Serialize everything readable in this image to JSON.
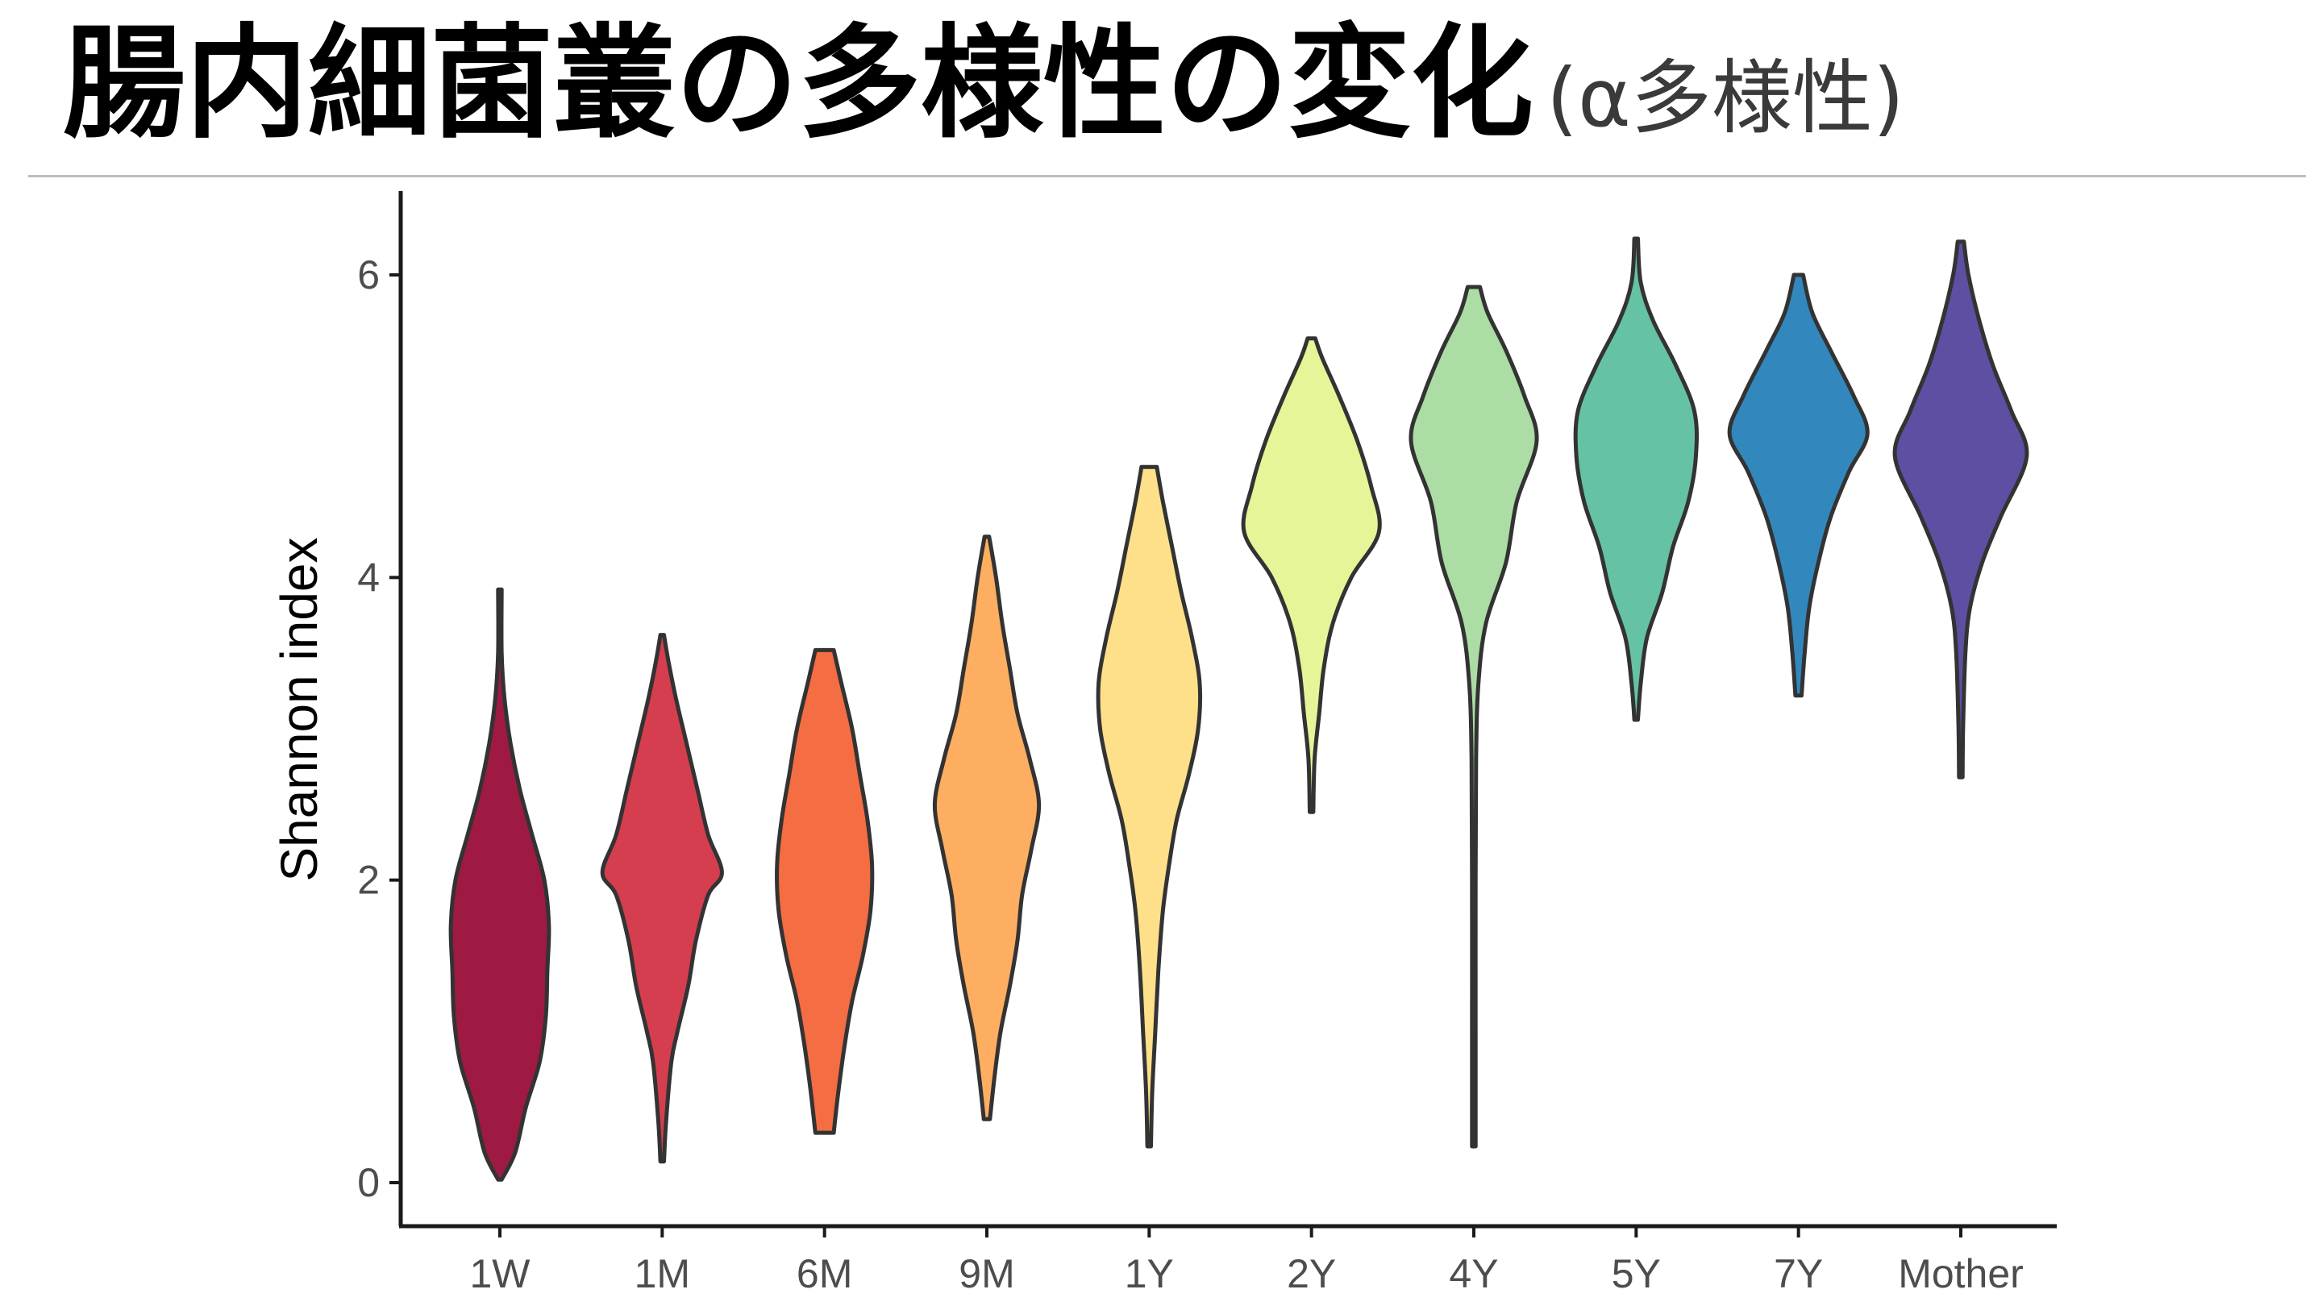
{
  "slide": {
    "title": "腸内細菌叢の多様性の変化",
    "subtitle": "(α多様性)"
  },
  "chart_data": {
    "type": "violin",
    "categories": [
      "1W",
      "1M",
      "6M",
      "9M",
      "1Y",
      "2Y",
      "4Y",
      "5Y",
      "7Y",
      "Mother"
    ],
    "ylabel": "Shannon index",
    "xlabel": "",
    "ylim": [
      -0.3,
      6.5
    ],
    "yticks": [
      0,
      2,
      4,
      6
    ],
    "grid": false,
    "legend": "none",
    "series": [
      {
        "group": "1W",
        "color": "#9E1A42",
        "min": 0.02,
        "max": 3.92,
        "profile": [
          [
            0.02,
            0.01
          ],
          [
            0.2,
            0.2
          ],
          [
            0.5,
            0.34
          ],
          [
            0.8,
            0.52
          ],
          [
            1.1,
            0.6
          ],
          [
            1.4,
            0.62
          ],
          [
            1.7,
            0.64
          ],
          [
            2.0,
            0.58
          ],
          [
            2.3,
            0.42
          ],
          [
            2.6,
            0.26
          ],
          [
            2.9,
            0.14
          ],
          [
            3.2,
            0.06
          ],
          [
            3.5,
            0.02
          ],
          [
            3.92,
            0.01
          ]
        ]
      },
      {
        "group": "1M",
        "color": "#D53E4F",
        "min": 0.14,
        "max": 3.62,
        "profile": [
          [
            0.14,
            0.02
          ],
          [
            0.4,
            0.05
          ],
          [
            0.8,
            0.12
          ],
          [
            1.0,
            0.2
          ],
          [
            1.3,
            0.34
          ],
          [
            1.6,
            0.44
          ],
          [
            1.9,
            0.6
          ],
          [
            2.05,
            0.78
          ],
          [
            2.3,
            0.6
          ],
          [
            2.6,
            0.46
          ],
          [
            2.9,
            0.32
          ],
          [
            3.2,
            0.18
          ],
          [
            3.45,
            0.08
          ],
          [
            3.62,
            0.02
          ]
        ]
      },
      {
        "group": "6M",
        "color": "#F46D43",
        "min": 0.33,
        "max": 3.52,
        "profile": [
          [
            0.33,
            0.12
          ],
          [
            0.6,
            0.18
          ],
          [
            0.9,
            0.26
          ],
          [
            1.2,
            0.36
          ],
          [
            1.5,
            0.5
          ],
          [
            1.8,
            0.6
          ],
          [
            2.1,
            0.62
          ],
          [
            2.4,
            0.56
          ],
          [
            2.7,
            0.46
          ],
          [
            3.0,
            0.36
          ],
          [
            3.3,
            0.22
          ],
          [
            3.52,
            0.12
          ]
        ]
      },
      {
        "group": "9M",
        "color": "#FDAE61",
        "min": 0.42,
        "max": 4.27,
        "profile": [
          [
            0.42,
            0.04
          ],
          [
            0.7,
            0.1
          ],
          [
            1.0,
            0.18
          ],
          [
            1.3,
            0.3
          ],
          [
            1.6,
            0.4
          ],
          [
            1.9,
            0.46
          ],
          [
            2.2,
            0.58
          ],
          [
            2.5,
            0.68
          ],
          [
            2.8,
            0.56
          ],
          [
            3.1,
            0.4
          ],
          [
            3.4,
            0.3
          ],
          [
            3.7,
            0.2
          ],
          [
            4.0,
            0.12
          ],
          [
            4.27,
            0.03
          ]
        ]
      },
      {
        "group": "1Y",
        "color": "#FEE08B",
        "min": 0.24,
        "max": 4.73,
        "profile": [
          [
            0.24,
            0.01
          ],
          [
            0.6,
            0.04
          ],
          [
            1.0,
            0.08
          ],
          [
            1.4,
            0.12
          ],
          [
            1.8,
            0.18
          ],
          [
            2.1,
            0.26
          ],
          [
            2.4,
            0.36
          ],
          [
            2.7,
            0.52
          ],
          [
            3.0,
            0.64
          ],
          [
            3.3,
            0.66
          ],
          [
            3.6,
            0.56
          ],
          [
            3.9,
            0.42
          ],
          [
            4.2,
            0.3
          ],
          [
            4.5,
            0.18
          ],
          [
            4.73,
            0.1
          ]
        ]
      },
      {
        "group": "2Y",
        "color": "#E6F598",
        "min": 2.45,
        "max": 5.58,
        "profile": [
          [
            2.45,
            0.02
          ],
          [
            2.8,
            0.04
          ],
          [
            3.1,
            0.1
          ],
          [
            3.4,
            0.16
          ],
          [
            3.7,
            0.28
          ],
          [
            4.0,
            0.52
          ],
          [
            4.3,
            0.88
          ],
          [
            4.6,
            0.78
          ],
          [
            4.9,
            0.6
          ],
          [
            5.2,
            0.36
          ],
          [
            5.45,
            0.14
          ],
          [
            5.58,
            0.05
          ]
        ]
      },
      {
        "group": "4Y",
        "color": "#ABDDA4",
        "min": 0.24,
        "max": 5.92,
        "profile": [
          [
            0.24,
            0.01
          ],
          [
            1.0,
            0.02
          ],
          [
            2.0,
            0.02
          ],
          [
            2.8,
            0.03
          ],
          [
            3.3,
            0.06
          ],
          [
            3.7,
            0.16
          ],
          [
            4.1,
            0.42
          ],
          [
            4.5,
            0.56
          ],
          [
            4.9,
            0.82
          ],
          [
            5.2,
            0.66
          ],
          [
            5.5,
            0.42
          ],
          [
            5.75,
            0.18
          ],
          [
            5.92,
            0.08
          ]
        ]
      },
      {
        "group": "5Y",
        "color": "#66C2A5",
        "min": 3.06,
        "max": 6.24,
        "profile": [
          [
            3.06,
            0.02
          ],
          [
            3.3,
            0.06
          ],
          [
            3.6,
            0.14
          ],
          [
            3.9,
            0.34
          ],
          [
            4.2,
            0.48
          ],
          [
            4.5,
            0.68
          ],
          [
            4.8,
            0.78
          ],
          [
            5.1,
            0.76
          ],
          [
            5.4,
            0.52
          ],
          [
            5.7,
            0.22
          ],
          [
            5.95,
            0.06
          ],
          [
            6.24,
            0.01
          ]
        ]
      },
      {
        "group": "7Y",
        "color": "#3288BD",
        "min": 3.22,
        "max": 6.0,
        "profile": [
          [
            3.22,
            0.04
          ],
          [
            3.5,
            0.08
          ],
          [
            3.8,
            0.14
          ],
          [
            4.1,
            0.26
          ],
          [
            4.4,
            0.42
          ],
          [
            4.7,
            0.66
          ],
          [
            4.95,
            0.9
          ],
          [
            5.2,
            0.72
          ],
          [
            5.5,
            0.42
          ],
          [
            5.75,
            0.18
          ],
          [
            6.0,
            0.06
          ]
        ]
      },
      {
        "group": "Mother",
        "color": "#5E4FA2",
        "min": 2.68,
        "max": 6.22,
        "profile": [
          [
            2.68,
            0.02
          ],
          [
            3.0,
            0.03
          ],
          [
            3.5,
            0.06
          ],
          [
            3.8,
            0.12
          ],
          [
            4.1,
            0.28
          ],
          [
            4.4,
            0.52
          ],
          [
            4.8,
            0.86
          ],
          [
            5.1,
            0.66
          ],
          [
            5.4,
            0.42
          ],
          [
            5.7,
            0.24
          ],
          [
            6.0,
            0.1
          ],
          [
            6.22,
            0.04
          ]
        ]
      }
    ]
  }
}
